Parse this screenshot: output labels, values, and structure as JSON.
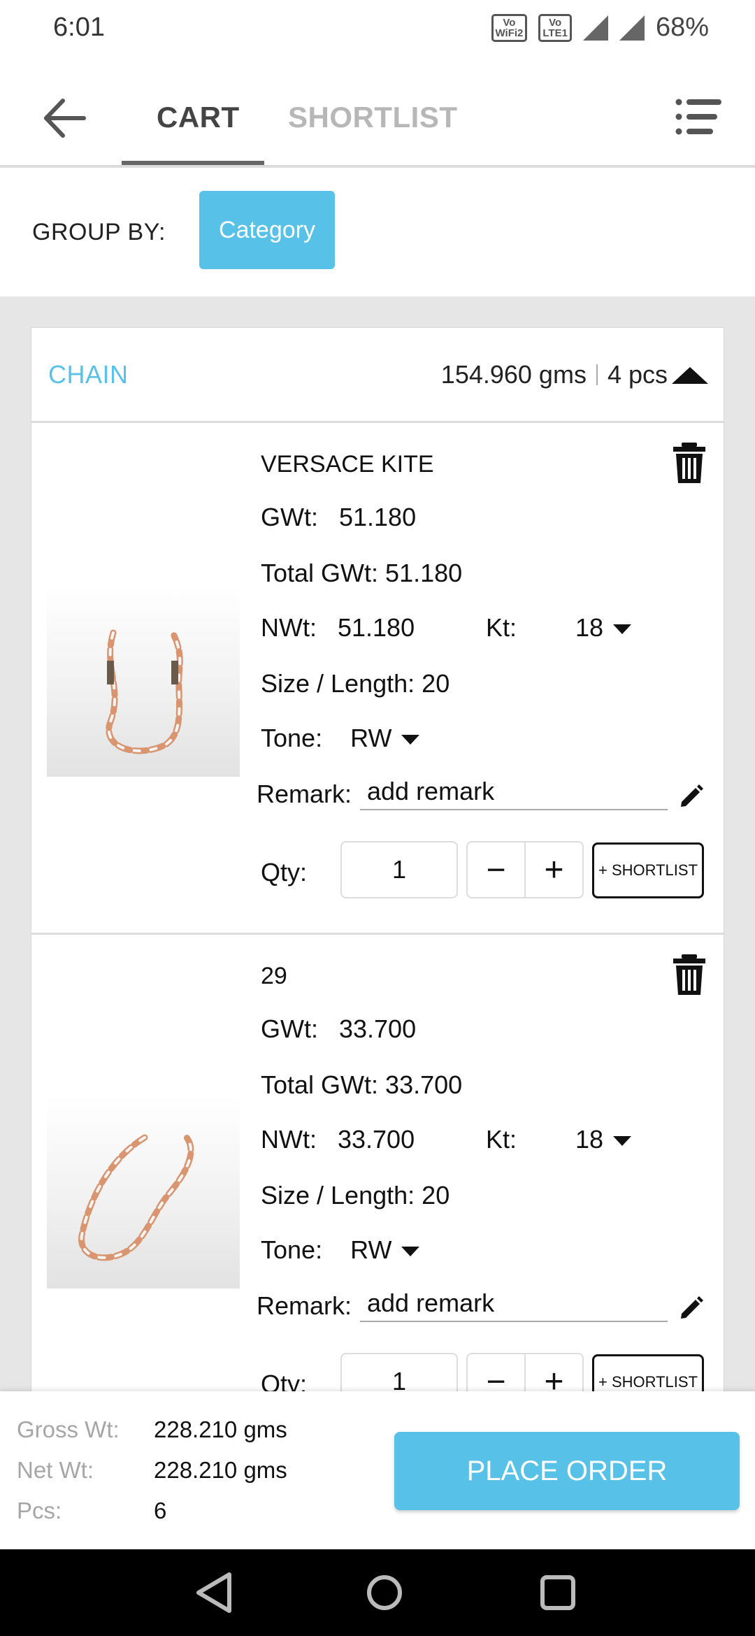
{
  "status_bar": {
    "time": "6:01",
    "badges": [
      {
        "top": "Vo",
        "bottom": "WiFi2"
      },
      {
        "top": "Vo",
        "bottom": "LTE1"
      }
    ],
    "battery": "68%"
  },
  "header": {
    "tabs": [
      {
        "label": "CART",
        "active": true
      },
      {
        "label": "SHORTLIST",
        "active": false
      }
    ],
    "back_icon": "arrow-left-icon",
    "menu_icon": "sort-menu-icon"
  },
  "group_by": {
    "label": "GROUP BY:",
    "button": "Category"
  },
  "groups": [
    {
      "title": "CHAIN",
      "weight": "154.960 gms",
      "pieces": "4 pcs",
      "items": [
        {
          "name": "VERSACE KITE",
          "gwt_label": "GWt:",
          "gwt": "51.180",
          "total_gwt_label": "Total GWt:",
          "total_gwt": "51.180",
          "nwt_label": "NWt:",
          "nwt": "51.180",
          "kt_label": "Kt:",
          "kt": "18",
          "size_label": "Size / Length:",
          "size": "20",
          "tone_label": "Tone:",
          "tone": "RW",
          "remark_label": "Remark:",
          "remark_placeholder": "add remark",
          "qty_label": "Qty:",
          "qty": "1",
          "minus": "−",
          "plus": "+",
          "shortlist": "+ SHORTLIST"
        },
        {
          "name": "29",
          "gwt_label": "GWt:",
          "gwt": "33.700",
          "total_gwt_label": "Total GWt:",
          "total_gwt": "33.700",
          "nwt_label": "NWt:",
          "nwt": "33.700",
          "kt_label": "Kt:",
          "kt": "18",
          "size_label": "Size / Length:",
          "size": "20",
          "tone_label": "Tone:",
          "tone": "RW",
          "remark_label": "Remark:",
          "remark_placeholder": "add remark",
          "qty_label": "Qty:",
          "qty": "1",
          "minus": "−",
          "plus": "+",
          "shortlist": "+ SHORTLIST"
        }
      ]
    }
  ],
  "footer": {
    "gross_label": "Gross Wt:",
    "gross_value": "228.210 gms",
    "net_label": "Net Wt:",
    "net_value": "228.210 gms",
    "pcs_label": "Pcs:",
    "pcs_value": "6",
    "place_order": "PLACE ORDER"
  },
  "colors": {
    "accent": "#57c1e8",
    "text": "#111111",
    "muted": "#a6a6a6"
  }
}
